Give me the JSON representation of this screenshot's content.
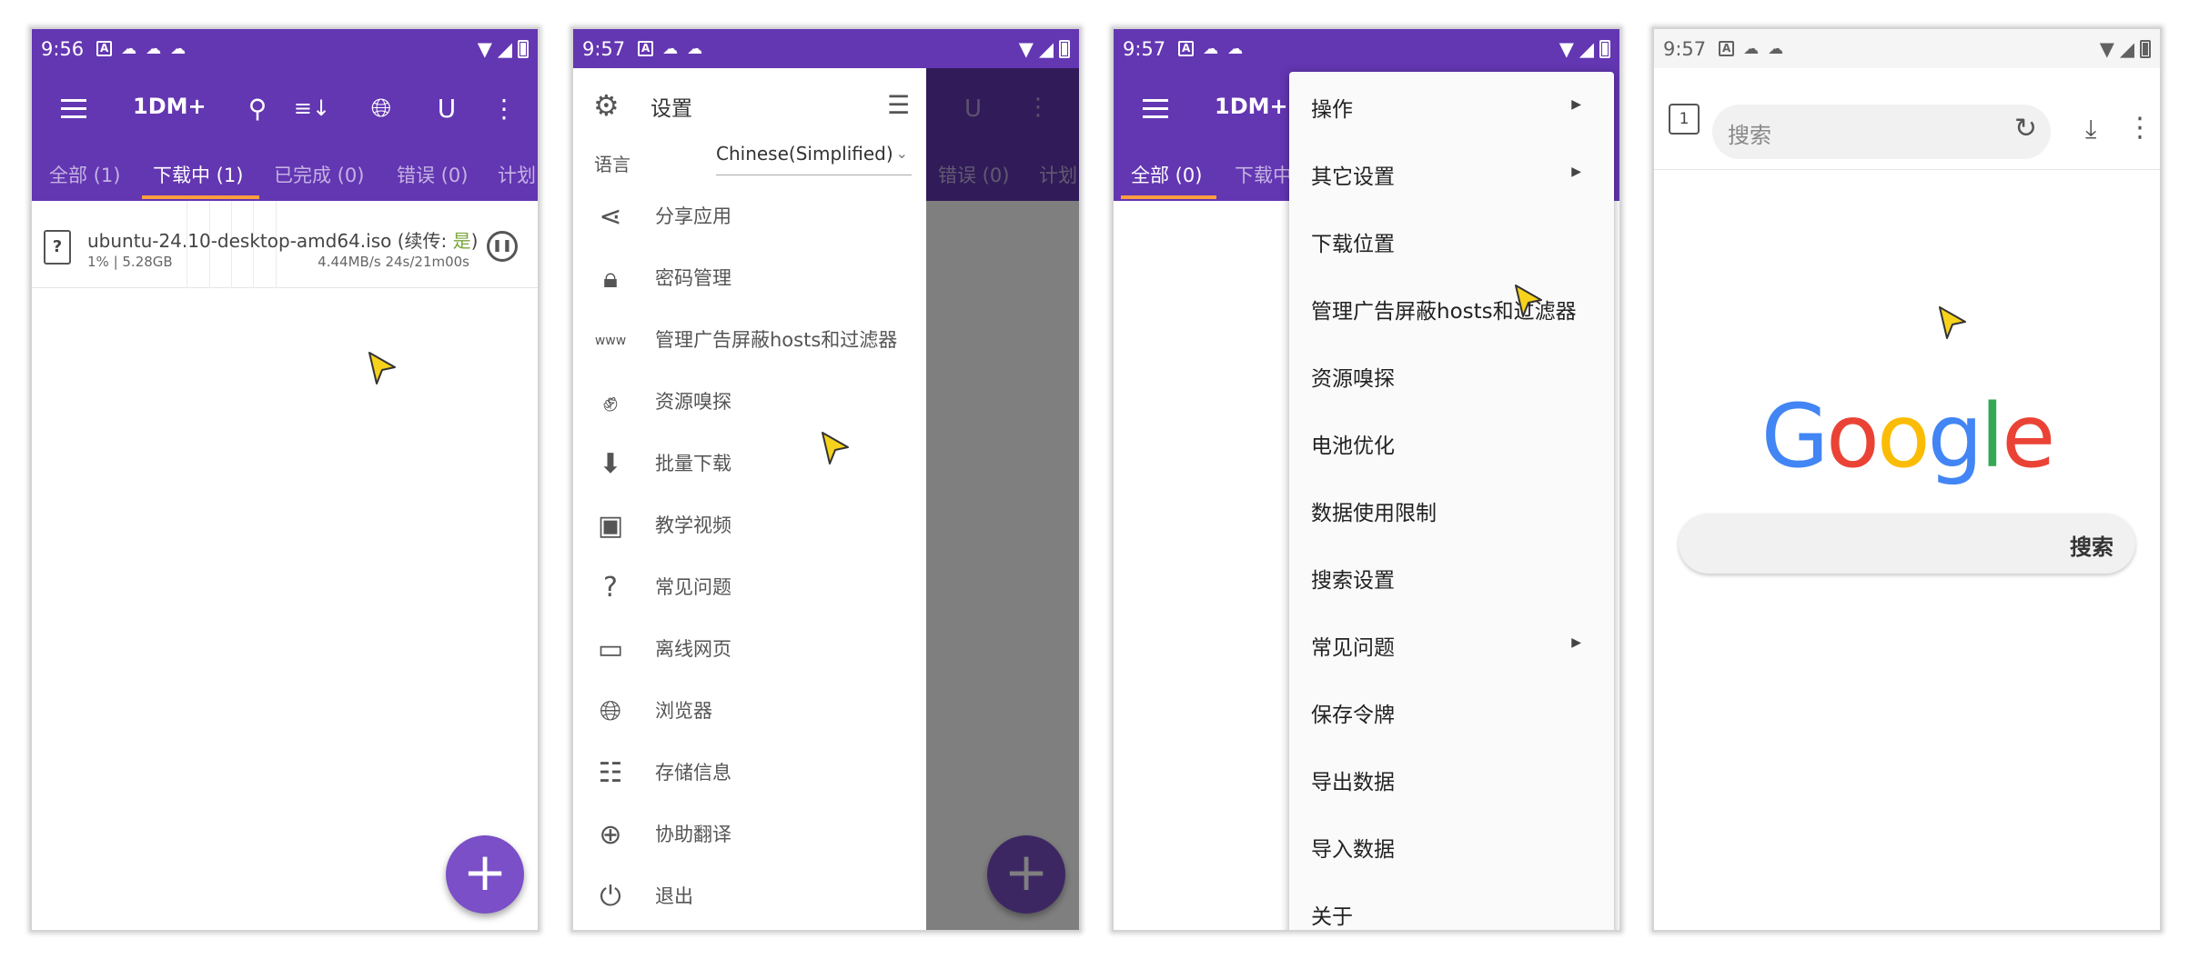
{
  "screens": [
    {
      "status": {
        "time": "9:56"
      },
      "app_title": "1DM+",
      "tabs": [
        "全部 (1)",
        "下载中 (1)",
        "已完成 (0)",
        "错误 (0)",
        "计划"
      ],
      "download": {
        "name": "ubuntu-24.10-desktop-amd64.iso",
        "resume_label": "续传:",
        "resume_value": "是",
        "progress_size": "1% | 5.28GB",
        "speed_eta": "4.44MB/s  24s/21m00s",
        "progress_percent": 1
      },
      "fab_label": "+"
    },
    {
      "status": {
        "time": "9:57"
      },
      "drawer": {
        "title": "设置",
        "language_label": "语言",
        "language_value": "Chinese(Simplified)",
        "items": [
          {
            "icon": "share-icon",
            "label": "分享应用"
          },
          {
            "icon": "lock-icon",
            "label": "密码管理"
          },
          {
            "icon": "www-icon",
            "label": "管理广告屏蔽hosts和过滤器"
          },
          {
            "icon": "fist-icon",
            "label": "资源嗅探"
          },
          {
            "icon": "download-circle-icon",
            "label": "批量下载"
          },
          {
            "icon": "video-tutorial-icon",
            "label": "教学视频"
          },
          {
            "icon": "faq-icon",
            "label": "常见问题"
          },
          {
            "icon": "offline-page-icon",
            "label": "离线网页"
          },
          {
            "icon": "globe-icon",
            "label": "浏览器"
          },
          {
            "icon": "storage-icon",
            "label": "存储信息"
          },
          {
            "icon": "translate-icon",
            "label": "协助翻译"
          },
          {
            "icon": "power-icon",
            "label": "退出"
          }
        ]
      },
      "dim_tabs": [
        "错误 (0)",
        "计划"
      ]
    },
    {
      "status": {
        "time": "9:57"
      },
      "app_title": "1DM+",
      "tabs": [
        "全部 (0)",
        "下载中"
      ],
      "menu_items": [
        {
          "label": "操作",
          "submenu": true
        },
        {
          "label": "其它设置",
          "submenu": true
        },
        {
          "label": "下载位置",
          "submenu": false
        },
        {
          "label": "管理广告屏蔽hosts和过滤器",
          "submenu": false
        },
        {
          "label": "资源嗅探",
          "submenu": false
        },
        {
          "label": "电池优化",
          "submenu": false
        },
        {
          "label": "数据使用限制",
          "submenu": false
        },
        {
          "label": "搜索设置",
          "submenu": false
        },
        {
          "label": "常见问题",
          "submenu": true
        },
        {
          "label": "保存令牌",
          "submenu": false
        },
        {
          "label": "导出数据",
          "submenu": false
        },
        {
          "label": "导入数据",
          "submenu": false
        },
        {
          "label": "关于",
          "submenu": false
        }
      ]
    },
    {
      "status": {
        "time": "9:57"
      },
      "browser": {
        "tab_count": "1",
        "url_placeholder": "搜索",
        "logo": [
          "G",
          "o",
          "o",
          "g",
          "l",
          "e"
        ],
        "search_button": "搜索"
      }
    }
  ],
  "colors": {
    "brand_purple": "#6336b2",
    "fab_purple": "#7b4fc7",
    "tab_indicator": "#ff9e40",
    "resume_green": "#7aa53c",
    "google_blue": "#4285f4",
    "google_red": "#ea4335",
    "google_yellow": "#fbbc05",
    "google_green": "#34a853",
    "cursor_yellow": "#f6d21c"
  }
}
